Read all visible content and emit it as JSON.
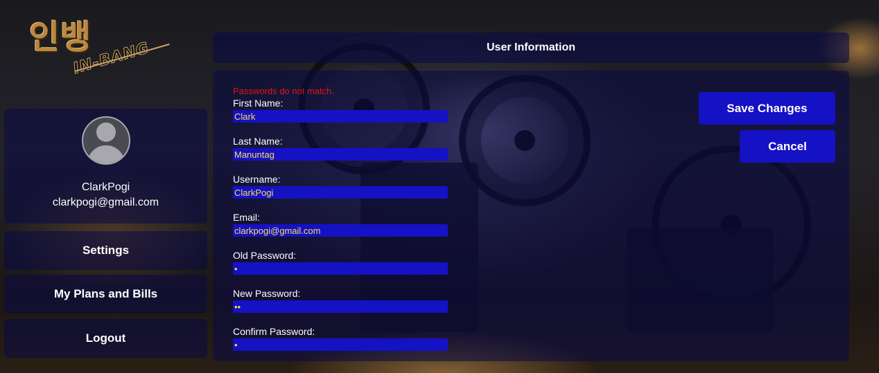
{
  "logo": {
    "korean": "인뱅",
    "english": "IN-BANG"
  },
  "profile": {
    "name": "ClarkPogi",
    "email": "clarkpogi@gmail.com",
    "avatar_icon": "user-avatar-icon"
  },
  "nav": {
    "settings": "Settings",
    "plans": "My Plans and Bills",
    "logout": "Logout"
  },
  "header": {
    "title": "User Information"
  },
  "form": {
    "error": "Passwords do not match.",
    "first_name": {
      "label": "First Name:",
      "value": "Clark"
    },
    "last_name": {
      "label": "Last Name:",
      "value": "Manuntag"
    },
    "username": {
      "label": "Username:",
      "value": "ClarkPogi"
    },
    "email": {
      "label": "Email:",
      "value": "clarkpogi@gmail.com"
    },
    "old_password": {
      "label": "Old Password:",
      "value": "•"
    },
    "new_password": {
      "label": "New Password:",
      "value": "••"
    },
    "confirm_password": {
      "label": "Confirm Password:",
      "value": "•"
    }
  },
  "actions": {
    "save": "Save Changes",
    "cancel": "Cancel"
  },
  "colors": {
    "accent": "#1511c4",
    "input_text": "#f4e04a",
    "error": "#e01515"
  }
}
